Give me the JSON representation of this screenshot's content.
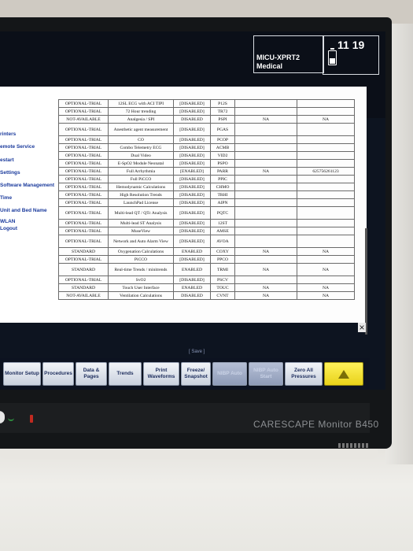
{
  "header": {
    "unit_line1": "MICU-XPRT2",
    "unit_line2": "Medical",
    "time": "11 19"
  },
  "menu": {
    "items": [
      {
        "label": "rinters"
      },
      {
        "label": "emote Service"
      },
      {
        "label": "estart"
      },
      {
        "label": "Settings"
      },
      {
        "label": "Software Management"
      },
      {
        "label": "Time"
      },
      {
        "label": "Unit and Bed Name"
      },
      {
        "label": "WLAN"
      },
      {
        "label": "Logout"
      }
    ]
  },
  "options_table": {
    "rows": [
      {
        "status": "OPTIONAL-TRIAL",
        "feature": "12SL ECG with ACI TIPI",
        "state": "[DISABLED]",
        "code": "P12S",
        "col5": "",
        "col6": ""
      },
      {
        "status": "OPTIONAL-TRIAL",
        "feature": "72 Hour trending",
        "state": "[DISABLED]",
        "code": "TR72",
        "col5": "",
        "col6": ""
      },
      {
        "status": "NOT-AVAILABLE",
        "feature": "Analgesia / SPI",
        "state": "DISABLED",
        "code": "PSPI",
        "col5": "NA",
        "col6": "NA"
      },
      {
        "status": "OPTIONAL-TRIAL",
        "feature": "Anesthetic agent measurement",
        "state": "[DISABLED]",
        "code": "PGAS",
        "col5": "",
        "col6": ""
      },
      {
        "status": "OPTIONAL-TRIAL",
        "feature": "CO",
        "state": "[DISABLED]",
        "code": "PCOP",
        "col5": "",
        "col6": ""
      },
      {
        "status": "OPTIONAL-TRIAL",
        "feature": "Combo Telemetry ECG",
        "state": "[DISABLED]",
        "code": "ACMB",
        "col5": "",
        "col6": ""
      },
      {
        "status": "OPTIONAL-TRIAL",
        "feature": "Dual Video",
        "state": "[DISABLED]",
        "code": "VID2",
        "col5": "",
        "col6": ""
      },
      {
        "status": "OPTIONAL-TRIAL",
        "feature": "E-SpO2 Module Neonatal",
        "state": "[DISABLED]",
        "code": "PSPO",
        "col5": "",
        "col6": ""
      },
      {
        "status": "OPTIONAL-TRIAL",
        "feature": "Full Arrhythmia",
        "state": "[ENABLED]",
        "code": "PARR",
        "col5": "NA",
        "col6": "625756261123"
      },
      {
        "status": "OPTIONAL-TRIAL",
        "feature": "Full PiCCO",
        "state": "[DISABLED]",
        "code": "PPIC",
        "col5": "",
        "col6": ""
      },
      {
        "status": "OPTIONAL-TRIAL",
        "feature": "Hemodynamic Calculations",
        "state": "[DISABLED]",
        "code": "CHMO",
        "col5": "",
        "col6": ""
      },
      {
        "status": "OPTIONAL-TRIAL",
        "feature": "High Resolution Trends",
        "state": "[DISABLED]",
        "code": "TRHI",
        "col5": "",
        "col6": ""
      },
      {
        "status": "OPTIONAL-TRIAL",
        "feature": "LaunchPad License",
        "state": "[DISABLED]",
        "code": "AIPN",
        "col5": "",
        "col6": ""
      },
      {
        "status": "OPTIONAL-TRIAL",
        "feature": "Multi-lead QT / QTc Analysis",
        "state": "[DISABLED]",
        "code": "PQTC",
        "col5": "",
        "col6": ""
      },
      {
        "status": "OPTIONAL-TRIAL",
        "feature": "Multi-lead ST Analysis",
        "state": "[DISABLED]",
        "code": "12ST",
        "col5": "",
        "col6": ""
      },
      {
        "status": "OPTIONAL-TRIAL",
        "feature": "MuseView",
        "state": "[DISABLED]",
        "code": "AMSE",
        "col5": "",
        "col6": ""
      },
      {
        "status": "OPTIONAL-TRIAL",
        "feature": "Network and Auto Alarm View",
        "state": "[DISABLED]",
        "code": "AVOA",
        "col5": "",
        "col6": ""
      },
      {
        "status": "STANDARD",
        "feature": "Oxygenation Calculations",
        "state": "ENABLED",
        "code": "COXY",
        "col5": "NA",
        "col6": "NA"
      },
      {
        "status": "OPTIONAL-TRIAL",
        "feature": "PiCCO",
        "state": "[DISABLED]",
        "code": "PPCO",
        "col5": "",
        "col6": ""
      },
      {
        "status": "STANDARD",
        "feature": "Real-time Trends / minitrends",
        "state": "ENABLED",
        "code": "TRMI",
        "col5": "NA",
        "col6": "NA"
      },
      {
        "status": "OPTIONAL-TRIAL",
        "feature": "SvO2",
        "state": "[DISABLED]",
        "code": "PSCV",
        "col5": "",
        "col6": ""
      },
      {
        "status": "STANDARD",
        "feature": "Touch User Interface",
        "state": "ENABLED",
        "code": "TOUC",
        "col5": "NA",
        "col6": "NA"
      },
      {
        "status": "NOT-AVAILABLE",
        "feature": "Ventilation Calculations",
        "state": "DISABLED",
        "code": "CVNT",
        "col5": "NA",
        "col6": "NA"
      }
    ],
    "save_label": "[ Save ]"
  },
  "toolbar": {
    "buttons": [
      {
        "label": "Monitor Setup"
      },
      {
        "label": "Procedures"
      },
      {
        "label": "Data & Pages"
      },
      {
        "label": "Trends"
      },
      {
        "label": "Print Waveforms"
      },
      {
        "label": "Freeze/ Snapshot"
      },
      {
        "label": "NIBP Auto"
      },
      {
        "label": "NIBP Auto Start"
      },
      {
        "label": "Zero All Pressures"
      }
    ]
  },
  "device": {
    "brand": "CARESCAPE Monitor B450"
  },
  "colors": {
    "menu_text": "#1a3a9c",
    "alarm_button": "#f0e030",
    "screen_bg": "#0d1420"
  }
}
